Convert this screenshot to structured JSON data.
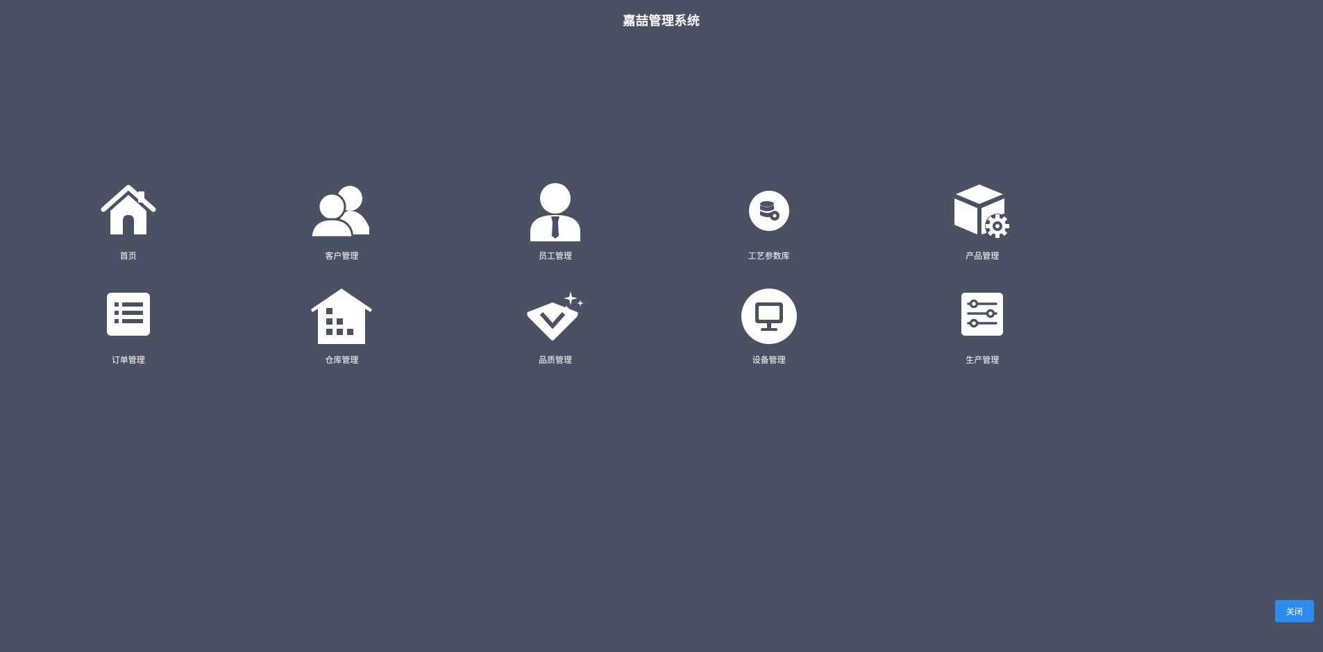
{
  "app": {
    "title": "嘉喆管理系统"
  },
  "tiles": [
    {
      "label": "首页",
      "icon": "home-icon"
    },
    {
      "label": "客户管理",
      "icon": "customers-icon"
    },
    {
      "label": "员工管理",
      "icon": "employee-icon"
    },
    {
      "label": "工艺参数库",
      "icon": "database-icon"
    },
    {
      "label": "产品管理",
      "icon": "product-box-gear-icon"
    },
    {
      "label": "订单管理",
      "icon": "order-list-icon"
    },
    {
      "label": "仓库管理",
      "icon": "warehouse-icon"
    },
    {
      "label": "品质管理",
      "icon": "diamond-icon"
    },
    {
      "label": "设备管理",
      "icon": "monitor-icon"
    },
    {
      "label": "生产管理",
      "icon": "sliders-icon"
    }
  ],
  "footer": {
    "close_label": "关闭"
  },
  "colors": {
    "background": "#4a5162",
    "accent": "#2d8cf0",
    "icon": "#ffffff"
  }
}
